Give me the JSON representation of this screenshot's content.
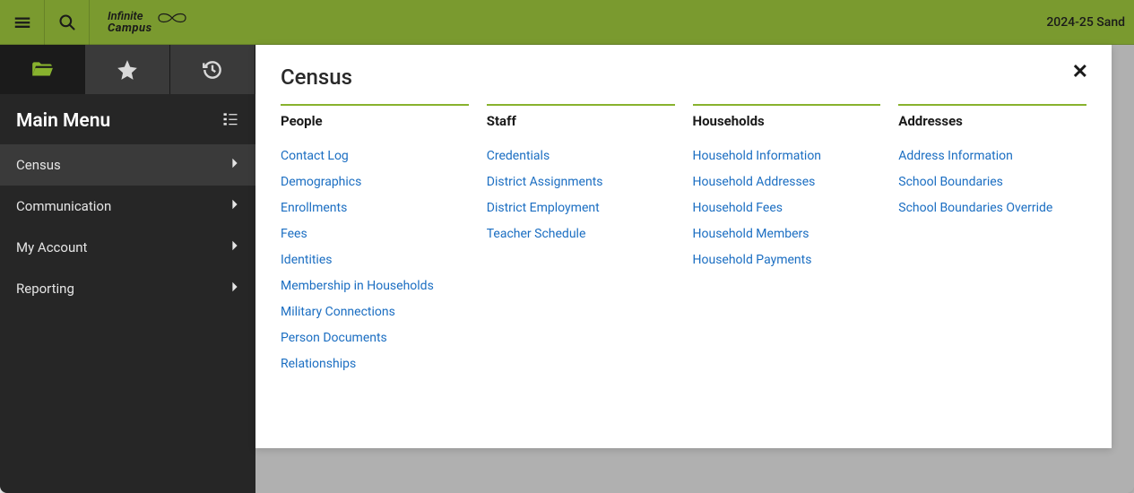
{
  "header": {
    "logo_top": "Infinite",
    "logo_bottom": "Campus",
    "context": "2024-25 Sand"
  },
  "sidebar": {
    "title": "Main Menu",
    "items": [
      {
        "label": "Census",
        "active": true
      },
      {
        "label": "Communication",
        "active": false
      },
      {
        "label": "My Account",
        "active": false
      },
      {
        "label": "Reporting",
        "active": false
      }
    ]
  },
  "panel": {
    "title": "Census",
    "columns": [
      {
        "header": "People",
        "links": [
          "Contact Log",
          "Demographics",
          "Enrollments",
          "Fees",
          "Identities",
          "Membership in Households",
          "Military Connections",
          "Person Documents",
          "Relationships"
        ]
      },
      {
        "header": "Staff",
        "links": [
          "Credentials",
          "District Assignments",
          "District Employment",
          "Teacher Schedule"
        ]
      },
      {
        "header": "Households",
        "links": [
          "Household Information",
          "Household Addresses",
          "Household Fees",
          "Household Members",
          "Household Payments"
        ]
      },
      {
        "header": "Addresses",
        "links": [
          "Address Information",
          "School Boundaries",
          "School Boundaries Override"
        ]
      }
    ]
  }
}
